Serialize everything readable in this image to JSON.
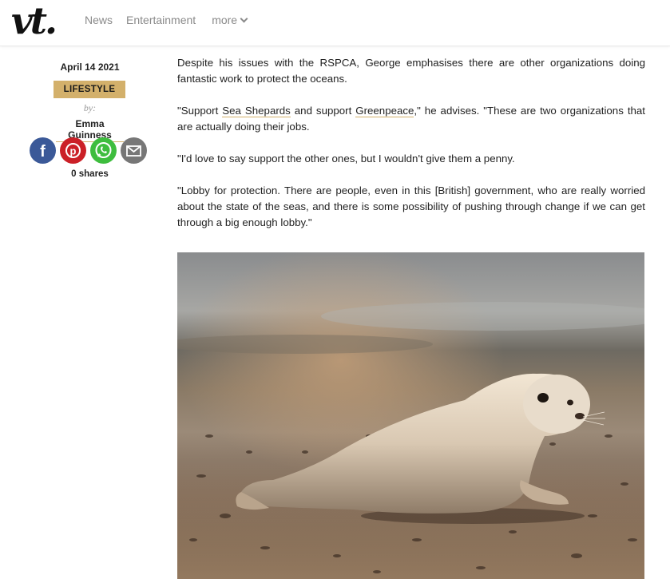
{
  "header": {
    "logo": "vt.",
    "nav": {
      "news": "News",
      "entertainment": "Entertainment",
      "more": "more"
    }
  },
  "meta": {
    "date": "April 14 2021",
    "category": "LIFESTYLE",
    "by_label": "by:",
    "author": "Emma Guinness",
    "share_icons": [
      "facebook-icon",
      "pinterest-icon",
      "whatsapp-icon",
      "email-icon"
    ],
    "shares": "0 shares"
  },
  "article": {
    "p1": "Despite his issues with the RSPCA, George emphasises there are other organizations doing fantastic work to protect the oceans.",
    "p2_pre": "\"Support ",
    "p2_link1": "Sea Shepards",
    "p2_mid": " and support ",
    "p2_link2": "Greenpeace",
    "p2_post": ",\" he advises. \"These are two organizations that are actually doing their jobs.",
    "p3": "\"I'd love to say support the other ones, but I wouldn't give them a penny.",
    "p4": "\"Lobby for protection. There are people, even in this [British] government, who are really worried about the state of the seas, and there is some possibility of pushing through change if we can get through a big enough lobby.\""
  },
  "colors": {
    "accent": "#d3b06b",
    "facebook": "#3b5998",
    "pinterest": "#cb2027",
    "whatsapp": "#3ebd3e",
    "email": "#777777"
  }
}
